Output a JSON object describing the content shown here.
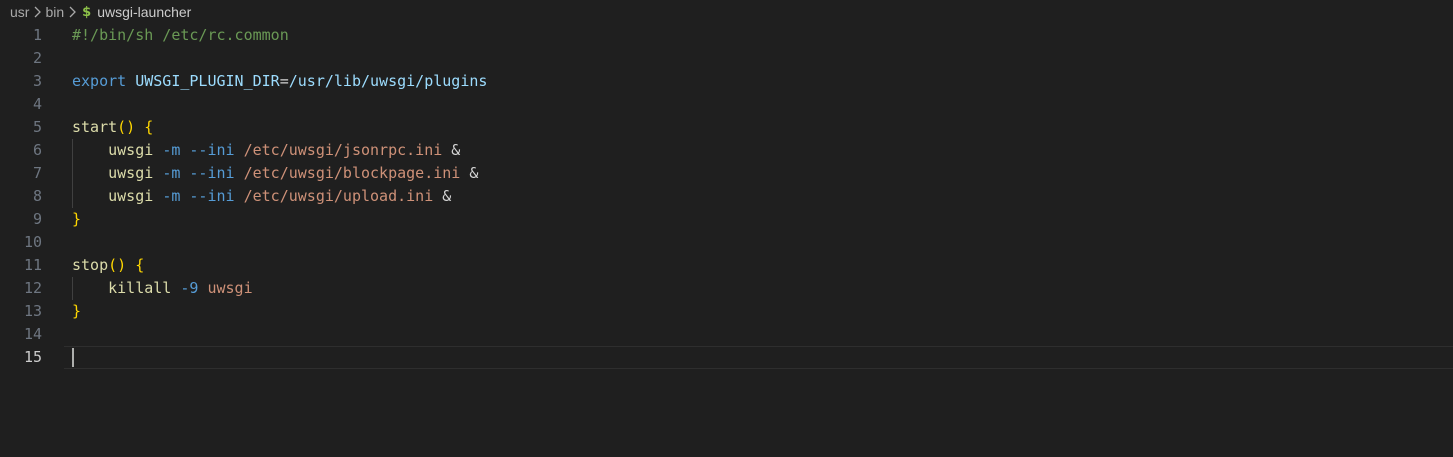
{
  "breadcrumb": {
    "items": [
      "usr",
      "bin"
    ],
    "file_icon": "$",
    "file": "uwsgi-launcher"
  },
  "editor": {
    "active_line": 15,
    "lines": [
      {
        "num": "1",
        "tokens": [
          {
            "t": "#!/bin/sh /etc/rc.common",
            "c": "comment"
          }
        ]
      },
      {
        "num": "2",
        "tokens": []
      },
      {
        "num": "3",
        "tokens": [
          {
            "t": "export",
            "c": "keyword"
          },
          {
            "t": " ",
            "c": "plain"
          },
          {
            "t": "UWSGI_PLUGIN_DIR",
            "c": "variable"
          },
          {
            "t": "=",
            "c": "plain"
          },
          {
            "t": "/usr/lib/uwsgi/plugins",
            "c": "variable"
          }
        ]
      },
      {
        "num": "4",
        "tokens": []
      },
      {
        "num": "5",
        "tokens": [
          {
            "t": "start",
            "c": "func"
          },
          {
            "t": "()",
            "c": "brace"
          },
          {
            "t": " ",
            "c": "plain"
          },
          {
            "t": "{",
            "c": "brace"
          }
        ]
      },
      {
        "num": "6",
        "tokens": [
          {
            "t": "    uwsgi",
            "c": "func"
          },
          {
            "t": " ",
            "c": "plain"
          },
          {
            "t": "-m",
            "c": "flag"
          },
          {
            "t": " ",
            "c": "plain"
          },
          {
            "t": "--ini",
            "c": "flag"
          },
          {
            "t": " ",
            "c": "plain"
          },
          {
            "t": "/etc/uwsgi/jsonrpc.ini",
            "c": "string"
          },
          {
            "t": " &",
            "c": "plain"
          }
        ]
      },
      {
        "num": "7",
        "tokens": [
          {
            "t": "    uwsgi",
            "c": "func"
          },
          {
            "t": " ",
            "c": "plain"
          },
          {
            "t": "-m",
            "c": "flag"
          },
          {
            "t": " ",
            "c": "plain"
          },
          {
            "t": "--ini",
            "c": "flag"
          },
          {
            "t": " ",
            "c": "plain"
          },
          {
            "t": "/etc/uwsgi/blockpage.ini",
            "c": "string"
          },
          {
            "t": " &",
            "c": "plain"
          }
        ]
      },
      {
        "num": "8",
        "tokens": [
          {
            "t": "    uwsgi",
            "c": "func"
          },
          {
            "t": " ",
            "c": "plain"
          },
          {
            "t": "-m",
            "c": "flag"
          },
          {
            "t": " ",
            "c": "plain"
          },
          {
            "t": "--ini",
            "c": "flag"
          },
          {
            "t": " ",
            "c": "plain"
          },
          {
            "t": "/etc/uwsgi/upload.ini",
            "c": "string"
          },
          {
            "t": " &",
            "c": "plain"
          }
        ]
      },
      {
        "num": "9",
        "tokens": [
          {
            "t": "}",
            "c": "brace"
          }
        ]
      },
      {
        "num": "10",
        "tokens": []
      },
      {
        "num": "11",
        "tokens": [
          {
            "t": "stop",
            "c": "func"
          },
          {
            "t": "()",
            "c": "brace"
          },
          {
            "t": " ",
            "c": "plain"
          },
          {
            "t": "{",
            "c": "brace"
          }
        ]
      },
      {
        "num": "12",
        "tokens": [
          {
            "t": "    killall",
            "c": "func"
          },
          {
            "t": " ",
            "c": "plain"
          },
          {
            "t": "-9",
            "c": "flag"
          },
          {
            "t": " ",
            "c": "plain"
          },
          {
            "t": "uwsgi",
            "c": "string"
          }
        ]
      },
      {
        "num": "13",
        "tokens": [
          {
            "t": "}",
            "c": "brace"
          }
        ]
      },
      {
        "num": "14",
        "tokens": []
      },
      {
        "num": "15",
        "tokens": []
      }
    ]
  }
}
